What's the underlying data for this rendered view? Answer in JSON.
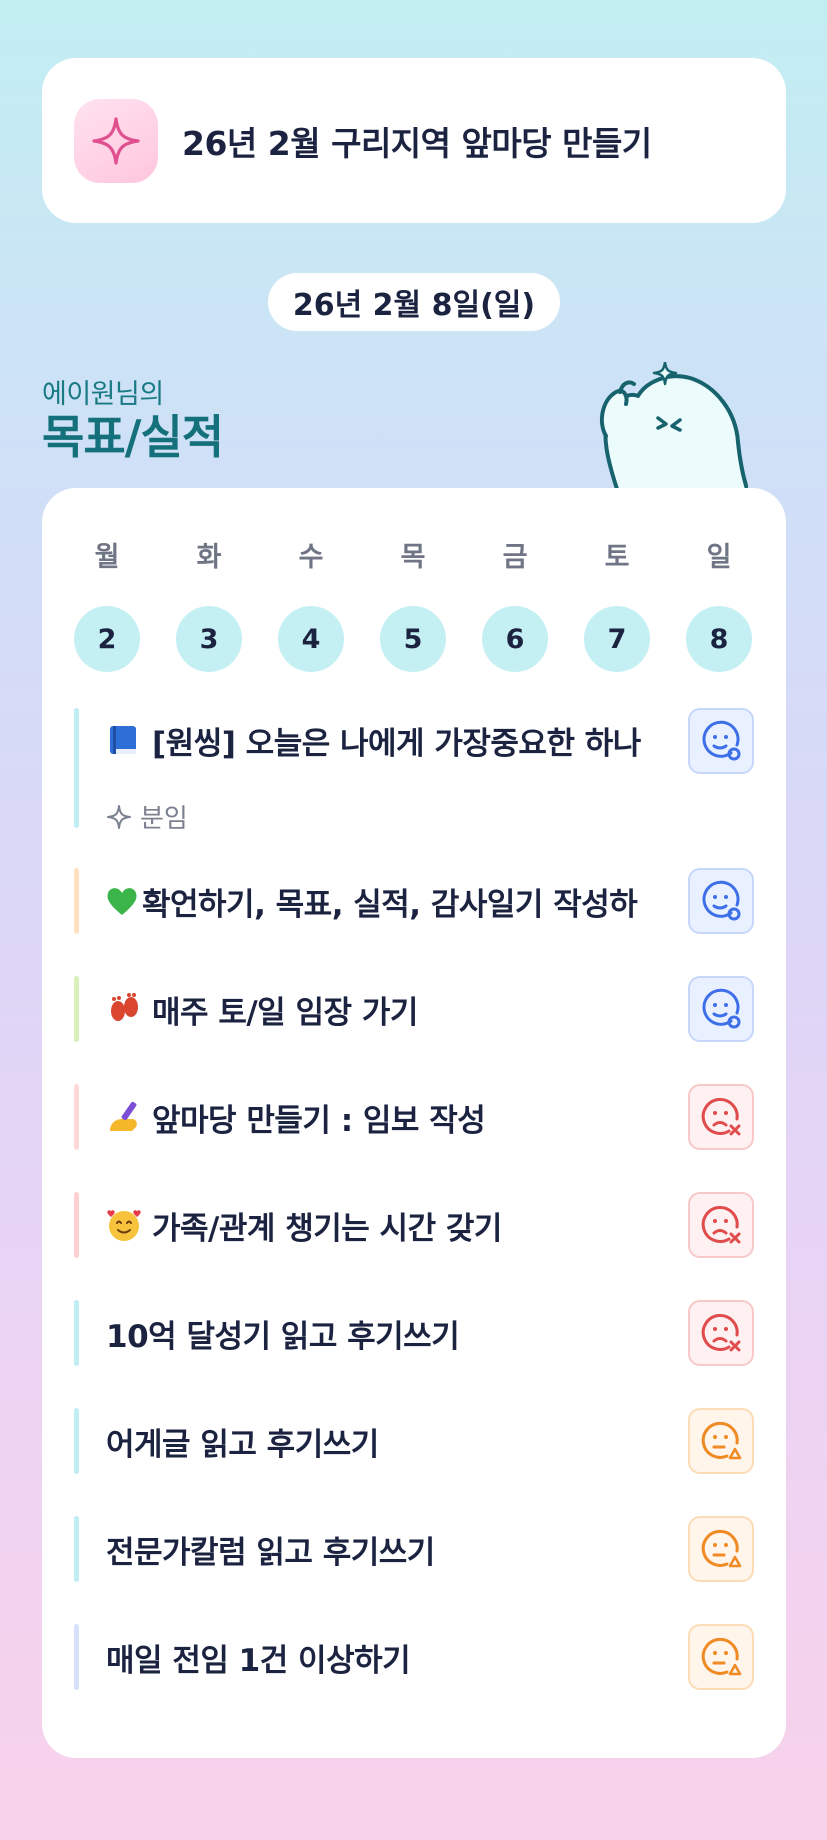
{
  "header": {
    "title": "26년 2월 구리지역 앞마당 만들기",
    "icon": "sparkle-icon"
  },
  "date_label": "26년 2월 8일(일)",
  "owner": {
    "name": "에이원님의",
    "title": "목표/실적"
  },
  "week": {
    "days": [
      {
        "label": "월",
        "num": "2"
      },
      {
        "label": "화",
        "num": "3"
      },
      {
        "label": "수",
        "num": "4"
      },
      {
        "label": "목",
        "num": "5"
      },
      {
        "label": "금",
        "num": "6"
      },
      {
        "label": "토",
        "num": "7"
      },
      {
        "label": "일",
        "num": "8"
      }
    ]
  },
  "tasks": [
    {
      "emoji": "book-icon",
      "text": "[원씽] 오늘은 나에게 가장중요한 하나",
      "sub": "분임",
      "status": "good",
      "bar_color": "#bfeef3"
    },
    {
      "emoji": "green-heart-icon",
      "text": "확언하기, 목표, 실적, 감사일기 작성하",
      "status": "good",
      "bar_color": "#ffe1c2"
    },
    {
      "emoji": "footprints-icon",
      "text": "매주 토/일 임장 가기",
      "status": "good",
      "bar_color": "#d9f0b8"
    },
    {
      "emoji": "writing-hand-icon",
      "text": "앞마당 만들기 : 임보 작성",
      "status": "bad",
      "bar_color": "#ffd9d9"
    },
    {
      "emoji": "smiling-hearts-icon",
      "text": "가족/관계 챙기는 시간 갖기",
      "status": "bad",
      "bar_color": "#ffd0d0"
    },
    {
      "emoji": "",
      "text": "10억 달성기 읽고 후기쓰기",
      "status": "bad",
      "bar_color": "#bfeef3"
    },
    {
      "emoji": "",
      "text": "어게글 읽고 후기쓰기",
      "status": "mid",
      "bar_color": "#bfeef3"
    },
    {
      "emoji": "",
      "text": "전문가칼럼 읽고 후기쓰기",
      "status": "mid",
      "bar_color": "#bfeef3"
    },
    {
      "emoji": "",
      "text": "매일 전임 1건 이상하기",
      "status": "mid",
      "bar_color": "#d6e2fb"
    }
  ],
  "status_colors": {
    "good": "#3d6fe8",
    "bad": "#e04b4b",
    "mid": "#f08a24"
  }
}
